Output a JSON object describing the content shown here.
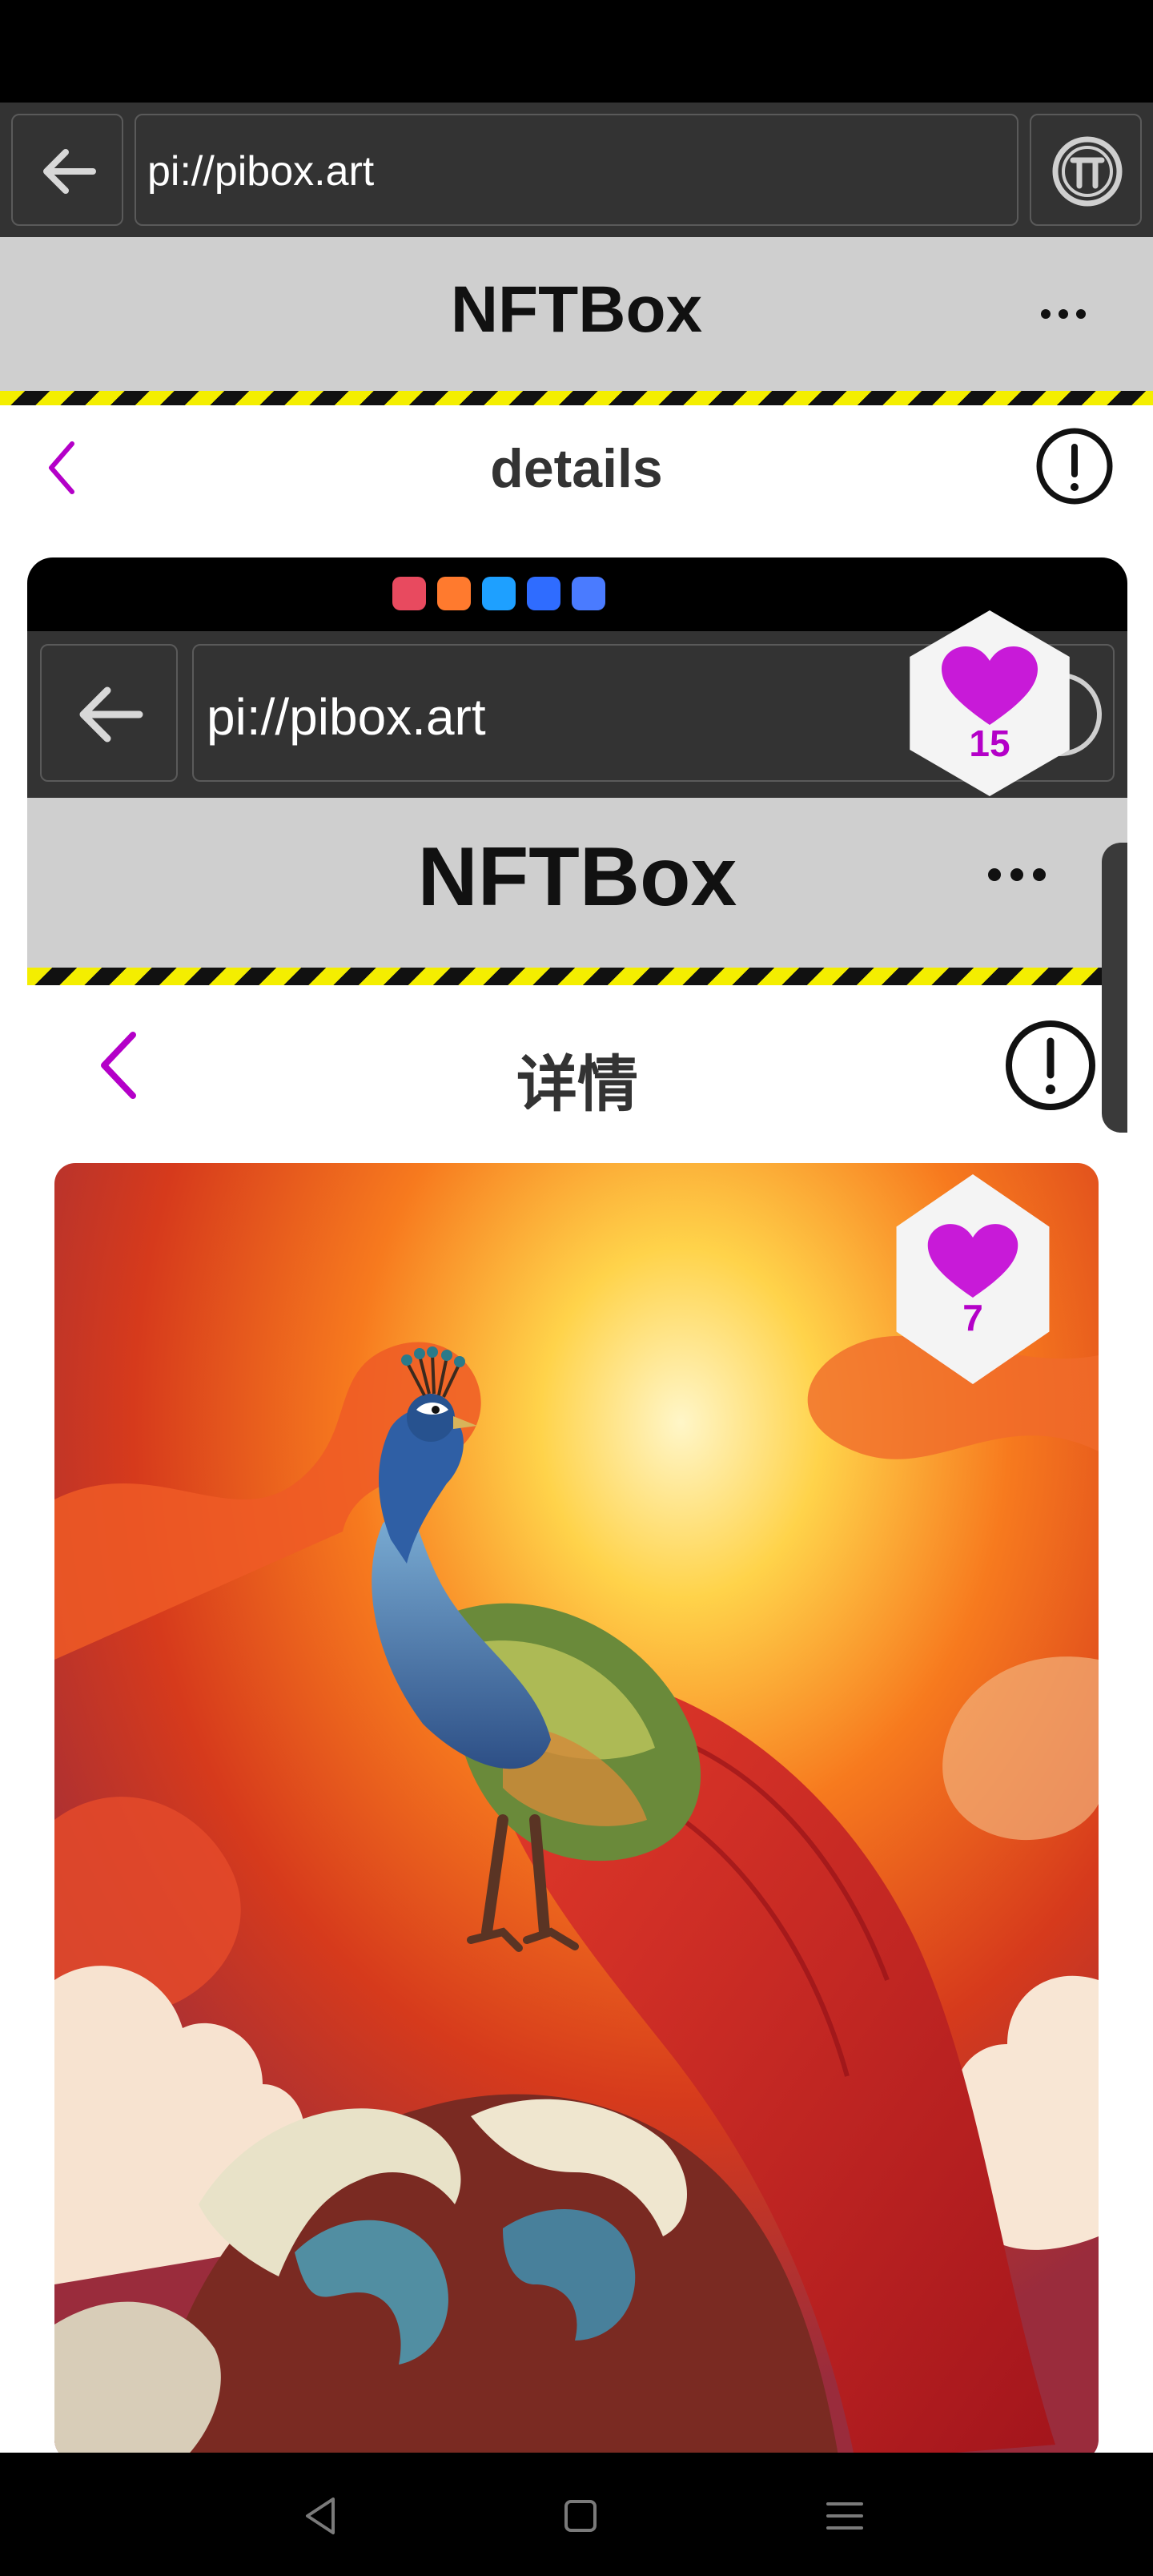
{
  "browser": {
    "url": "pi://pibox.art"
  },
  "app": {
    "title": "NFTBox"
  },
  "page": {
    "title": "details"
  },
  "embedded": {
    "url": "pi://pibox.art",
    "app_title": "NFTBox",
    "page_title": "详情",
    "overlay_like_count": "15",
    "artwork_like_count": "7"
  },
  "colors": {
    "accent": "#b400c8",
    "stripe_yellow": "#f4ee00",
    "header_gray": "#cfcfcf",
    "browser_bar": "#333333"
  },
  "icons": {
    "back": "arrow-left-icon",
    "pi": "pi-coin-icon",
    "more": "more-dots-icon",
    "chevron": "chevron-left-icon",
    "info": "exclamation-circle-icon",
    "heart": "heart-icon",
    "nav_back": "triangle-back-icon",
    "nav_home": "square-home-icon",
    "nav_menu": "menu-lines-icon"
  }
}
